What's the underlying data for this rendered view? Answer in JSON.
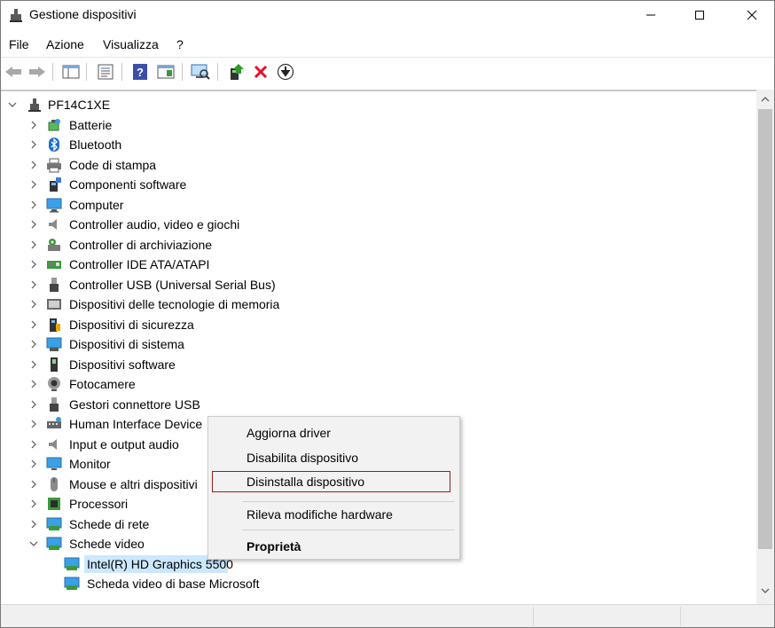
{
  "window": {
    "title": "Gestione dispositivi"
  },
  "menubar": {
    "items": [
      "File",
      "Azione",
      "Visualizza",
      "?"
    ]
  },
  "toolbar": {
    "buttons": [
      "back-icon",
      "forward-icon",
      "show-hide-console-tree-icon",
      "properties-icon",
      "help-icon",
      "action-pane-icon",
      "scan-hardware-icon",
      "update-driver-icon",
      "uninstall-icon",
      "disable-device-icon"
    ]
  },
  "tree": {
    "root": "PF14C1XE",
    "categories": [
      {
        "label": "Batterie",
        "icon": "battery-icon"
      },
      {
        "label": "Bluetooth",
        "icon": "bluetooth-icon"
      },
      {
        "label": "Code di stampa",
        "icon": "printer-icon"
      },
      {
        "label": "Componenti software",
        "icon": "software-component-icon"
      },
      {
        "label": "Computer",
        "icon": "computer-icon"
      },
      {
        "label": "Controller audio, video e giochi",
        "icon": "speaker-icon"
      },
      {
        "label": "Controller di archiviazione",
        "icon": "storage-controller-icon"
      },
      {
        "label": "Controller IDE ATA/ATAPI",
        "icon": "ide-controller-icon"
      },
      {
        "label": "Controller USB (Universal Serial Bus)",
        "icon": "usb-icon"
      },
      {
        "label": "Dispositivi delle tecnologie di memoria",
        "icon": "memory-device-icon"
      },
      {
        "label": "Dispositivi di sicurezza",
        "icon": "security-device-icon"
      },
      {
        "label": "Dispositivi di sistema",
        "icon": "system-device-icon"
      },
      {
        "label": "Dispositivi software",
        "icon": "software-device-icon"
      },
      {
        "label": "Fotocamere",
        "icon": "camera-icon"
      },
      {
        "label": "Gestori connettore USB",
        "icon": "usb-connector-icon"
      },
      {
        "label": "Human Interface Device",
        "icon": "hid-icon"
      },
      {
        "label": "Input e output audio",
        "icon": "audio-io-icon"
      },
      {
        "label": "Monitor",
        "icon": "monitor-icon"
      },
      {
        "label": "Mouse e altri dispositivi",
        "icon": "mouse-icon"
      },
      {
        "label": "Processori",
        "icon": "processor-icon"
      },
      {
        "label": "Schede di rete",
        "icon": "network-adapter-icon"
      },
      {
        "label": "Schede video",
        "icon": "display-adapter-icon"
      }
    ],
    "children": [
      {
        "label": "Intel(R) HD Graphics 5500",
        "selected": true
      },
      {
        "label": "Scheda video di base Microsoft",
        "selected": false
      }
    ]
  },
  "context_menu": {
    "items": [
      "Aggiorna driver",
      "Disabilita dispositivo",
      "Disinstalla dispositivo",
      "Rileva modifiche hardware",
      "Proprietà"
    ],
    "highlighted": "Disinstalla dispositivo"
  },
  "colors": {
    "selection": "#cce8ff",
    "highlight_border": "#9b1c1c",
    "uninstall_red": "#e0102a"
  }
}
